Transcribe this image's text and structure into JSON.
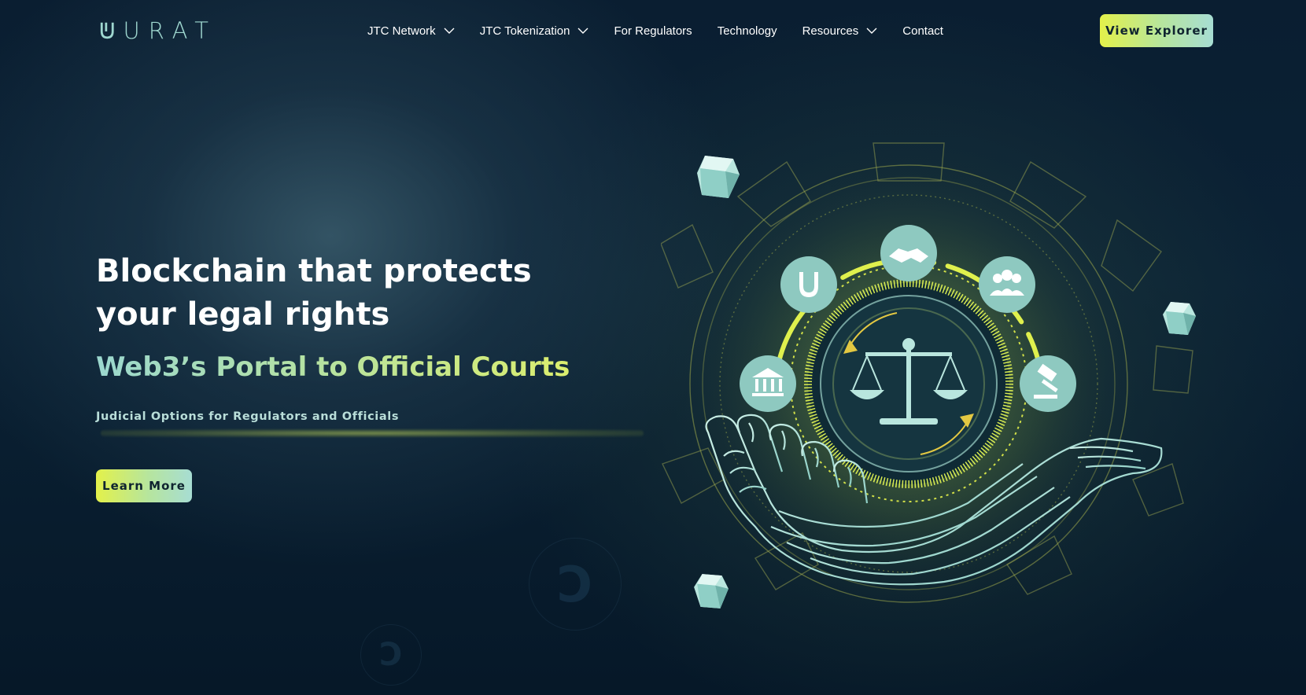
{
  "brand": {
    "name": "URAT",
    "accent_colors": [
      "#e3f14a",
      "#a7ddd3"
    ]
  },
  "nav": {
    "items": [
      {
        "label": "JTC Network",
        "has_dropdown": true
      },
      {
        "label": "JTC Tokenization",
        "has_dropdown": true
      },
      {
        "label": "For Regulators",
        "has_dropdown": false
      },
      {
        "label": "Technology",
        "has_dropdown": false
      },
      {
        "label": "Resources",
        "has_dropdown": true
      },
      {
        "label": "Contact",
        "has_dropdown": false
      }
    ],
    "cta_label": "View Explorer"
  },
  "hero": {
    "title_line1": "Blockchain that protects",
    "title_line2": "your legal rights",
    "subtitle": "Web3’s Portal to Official Courts",
    "tagline": "Judicial Options for Regulators and Officials",
    "cta_label": "Learn More"
  },
  "illustration": {
    "icons": [
      "handshake-icon",
      "shield-icon",
      "group-icon",
      "bank-icon",
      "gavel-icon",
      "scales-icon"
    ]
  }
}
